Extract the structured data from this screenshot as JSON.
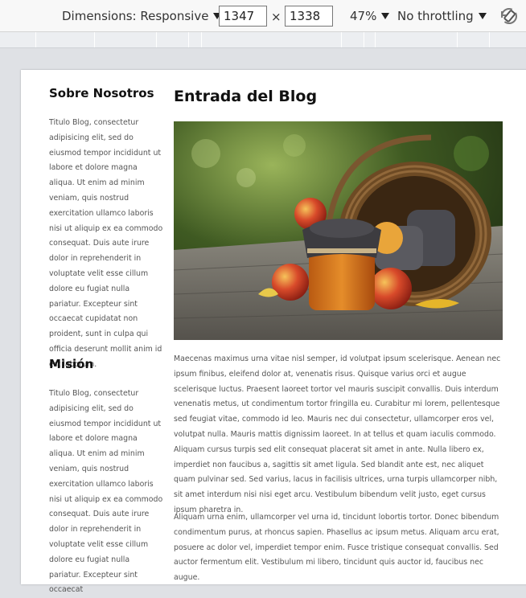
{
  "toolbar": {
    "dimensions_label": "Dimensions: Responsive",
    "width_value": "1347",
    "height_value": "1338",
    "times_symbol": "×",
    "zoom_label": "47%",
    "throttling_label": "No throttling",
    "rotate_icon": "rotate-icon",
    "caret_icon": "caret-down-icon"
  },
  "sidebar": {
    "sections": [
      {
        "title": "Sobre Nosotros",
        "text": "Titulo Blog, consectetur adipisicing elit, sed do eiusmod tempor incididunt ut labore et dolore magna aliqua. Ut enim ad minim veniam, quis nostrud exercitation ullamco laboris nisi ut aliquip ex ea commodo consequat. Duis aute irure dolor in reprehenderit in voluptate velit esse cillum dolore eu fugiat nulla pariatur. Excepteur sint occaecat cupidatat non proident, sunt in culpa qui officia deserunt mollit anim id est laborum."
      },
      {
        "title": "Misión",
        "text": "Titulo Blog, consectetur adipisicing elit, sed do eiusmod tempor incididunt ut labore et dolore magna aliqua. Ut enim ad minim veniam, quis nostrud exercitation ullamco laboris nisi ut aliquip ex ea commodo consequat. Duis aute irure dolor in reprehenderit in voluptate velit esse cillum dolore eu fugiat nulla pariatur. Excepteur sint occaecat"
      }
    ]
  },
  "main": {
    "title": "Entrada del Blog",
    "paragraphs": [
      "Maecenas maximus urna vitae nisl semper, id volutpat ipsum scelerisque. Aenean nec ipsum finibus, eleifend dolor at, venenatis risus. Quisque varius orci et augue scelerisque luctus. Praesent laoreet tortor vel mauris suscipit convallis. Duis interdum venenatis metus, ut condimentum tortor fringilla eu. Curabitur mi lorem, pellentesque sed feugiat vitae, commodo id leo. Mauris nec dui consectetur, ullamcorper eros vel, volutpat nulla. Mauris mattis dignissim laoreet. In at tellus et quam iaculis commodo. Aliquam cursus turpis sed elit consequat placerat sit amet in ante. Nulla libero ex, imperdiet non faucibus a, sagittis sit amet ligula. Sed blandit ante est, nec aliquet quam pulvinar sed. Sed varius, lacus in facilisis ultrices, urna turpis ullamcorper nibh, sit amet interdum nisi nisi eget arcu. Vestibulum bibendum velit justo, eget cursus ipsum pharetra in.",
      "Aliquam urna enim, ullamcorper vel urna id, tincidunt lobortis tortor. Donec bibendum condimentum purus, at rhoncus sapien. Phasellus ac ipsum metus. Aliquam arcu erat, posuere ac dolor vel, imperdiet tempor enim. Fusce tristique consequat convallis. Sed auctor fermentum elit. Vestibulum mi libero, tincidunt quis auctor id, faucibus nec augue."
    ]
  },
  "colors": {
    "toolbar_bg": "#f8f8f8",
    "ruler_bg": "#eceef1",
    "canvas_bg": "#dfe1e5",
    "page_bg": "#ffffff",
    "text": "#555555",
    "heading": "#111111"
  }
}
